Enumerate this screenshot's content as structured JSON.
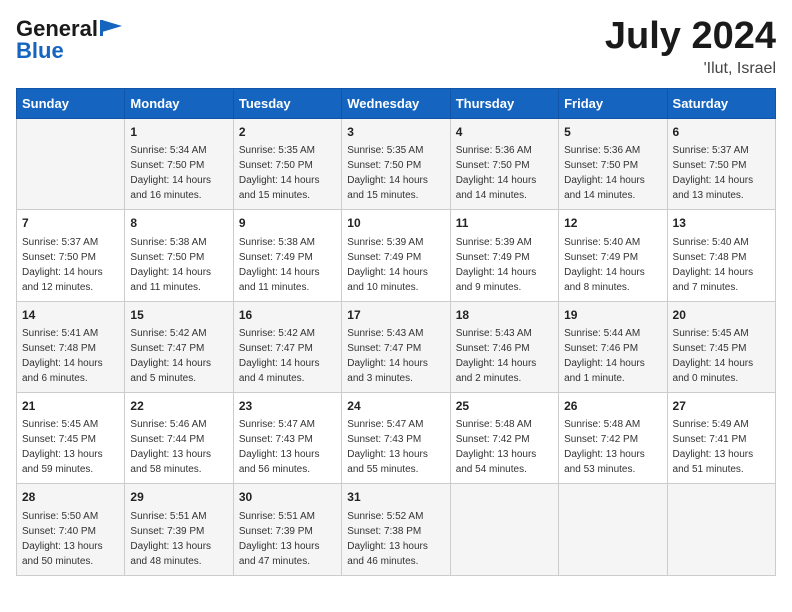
{
  "header": {
    "logo_general": "General",
    "logo_blue": "Blue",
    "month_year": "July 2024",
    "location": "'Ilut, Israel"
  },
  "days_of_week": [
    "Sunday",
    "Monday",
    "Tuesday",
    "Wednesday",
    "Thursday",
    "Friday",
    "Saturday"
  ],
  "weeks": [
    [
      {
        "day": "",
        "content": ""
      },
      {
        "day": "1",
        "content": "Sunrise: 5:34 AM\nSunset: 7:50 PM\nDaylight: 14 hours\nand 16 minutes."
      },
      {
        "day": "2",
        "content": "Sunrise: 5:35 AM\nSunset: 7:50 PM\nDaylight: 14 hours\nand 15 minutes."
      },
      {
        "day": "3",
        "content": "Sunrise: 5:35 AM\nSunset: 7:50 PM\nDaylight: 14 hours\nand 15 minutes."
      },
      {
        "day": "4",
        "content": "Sunrise: 5:36 AM\nSunset: 7:50 PM\nDaylight: 14 hours\nand 14 minutes."
      },
      {
        "day": "5",
        "content": "Sunrise: 5:36 AM\nSunset: 7:50 PM\nDaylight: 14 hours\nand 14 minutes."
      },
      {
        "day": "6",
        "content": "Sunrise: 5:37 AM\nSunset: 7:50 PM\nDaylight: 14 hours\nand 13 minutes."
      }
    ],
    [
      {
        "day": "7",
        "content": "Sunrise: 5:37 AM\nSunset: 7:50 PM\nDaylight: 14 hours\nand 12 minutes."
      },
      {
        "day": "8",
        "content": "Sunrise: 5:38 AM\nSunset: 7:50 PM\nDaylight: 14 hours\nand 11 minutes."
      },
      {
        "day": "9",
        "content": "Sunrise: 5:38 AM\nSunset: 7:49 PM\nDaylight: 14 hours\nand 11 minutes."
      },
      {
        "day": "10",
        "content": "Sunrise: 5:39 AM\nSunset: 7:49 PM\nDaylight: 14 hours\nand 10 minutes."
      },
      {
        "day": "11",
        "content": "Sunrise: 5:39 AM\nSunset: 7:49 PM\nDaylight: 14 hours\nand 9 minutes."
      },
      {
        "day": "12",
        "content": "Sunrise: 5:40 AM\nSunset: 7:49 PM\nDaylight: 14 hours\nand 8 minutes."
      },
      {
        "day": "13",
        "content": "Sunrise: 5:40 AM\nSunset: 7:48 PM\nDaylight: 14 hours\nand 7 minutes."
      }
    ],
    [
      {
        "day": "14",
        "content": "Sunrise: 5:41 AM\nSunset: 7:48 PM\nDaylight: 14 hours\nand 6 minutes."
      },
      {
        "day": "15",
        "content": "Sunrise: 5:42 AM\nSunset: 7:47 PM\nDaylight: 14 hours\nand 5 minutes."
      },
      {
        "day": "16",
        "content": "Sunrise: 5:42 AM\nSunset: 7:47 PM\nDaylight: 14 hours\nand 4 minutes."
      },
      {
        "day": "17",
        "content": "Sunrise: 5:43 AM\nSunset: 7:47 PM\nDaylight: 14 hours\nand 3 minutes."
      },
      {
        "day": "18",
        "content": "Sunrise: 5:43 AM\nSunset: 7:46 PM\nDaylight: 14 hours\nand 2 minutes."
      },
      {
        "day": "19",
        "content": "Sunrise: 5:44 AM\nSunset: 7:46 PM\nDaylight: 14 hours\nand 1 minute."
      },
      {
        "day": "20",
        "content": "Sunrise: 5:45 AM\nSunset: 7:45 PM\nDaylight: 14 hours\nand 0 minutes."
      }
    ],
    [
      {
        "day": "21",
        "content": "Sunrise: 5:45 AM\nSunset: 7:45 PM\nDaylight: 13 hours\nand 59 minutes."
      },
      {
        "day": "22",
        "content": "Sunrise: 5:46 AM\nSunset: 7:44 PM\nDaylight: 13 hours\nand 58 minutes."
      },
      {
        "day": "23",
        "content": "Sunrise: 5:47 AM\nSunset: 7:43 PM\nDaylight: 13 hours\nand 56 minutes."
      },
      {
        "day": "24",
        "content": "Sunrise: 5:47 AM\nSunset: 7:43 PM\nDaylight: 13 hours\nand 55 minutes."
      },
      {
        "day": "25",
        "content": "Sunrise: 5:48 AM\nSunset: 7:42 PM\nDaylight: 13 hours\nand 54 minutes."
      },
      {
        "day": "26",
        "content": "Sunrise: 5:48 AM\nSunset: 7:42 PM\nDaylight: 13 hours\nand 53 minutes."
      },
      {
        "day": "27",
        "content": "Sunrise: 5:49 AM\nSunset: 7:41 PM\nDaylight: 13 hours\nand 51 minutes."
      }
    ],
    [
      {
        "day": "28",
        "content": "Sunrise: 5:50 AM\nSunset: 7:40 PM\nDaylight: 13 hours\nand 50 minutes."
      },
      {
        "day": "29",
        "content": "Sunrise: 5:51 AM\nSunset: 7:39 PM\nDaylight: 13 hours\nand 48 minutes."
      },
      {
        "day": "30",
        "content": "Sunrise: 5:51 AM\nSunset: 7:39 PM\nDaylight: 13 hours\nand 47 minutes."
      },
      {
        "day": "31",
        "content": "Sunrise: 5:52 AM\nSunset: 7:38 PM\nDaylight: 13 hours\nand 46 minutes."
      },
      {
        "day": "",
        "content": ""
      },
      {
        "day": "",
        "content": ""
      },
      {
        "day": "",
        "content": ""
      }
    ]
  ]
}
